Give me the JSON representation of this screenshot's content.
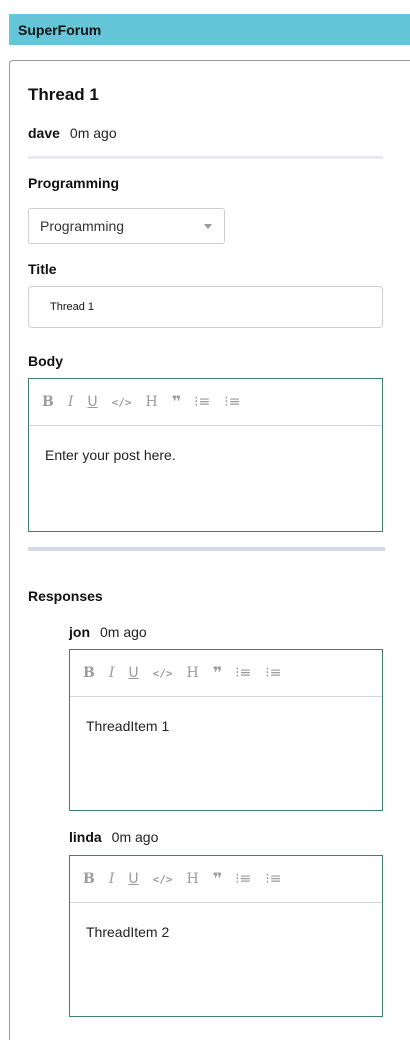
{
  "app": {
    "title": "SuperForum"
  },
  "thread": {
    "title": "Thread 1",
    "author": "dave",
    "time": "0m ago",
    "category_heading": "Programming",
    "category_selected": "Programming",
    "title_label": "Title",
    "title_value": "Thread 1",
    "body_label": "Body",
    "body_placeholder": "Enter your post here."
  },
  "toolbar": {
    "bold": "B",
    "italic": "I",
    "underline": "U",
    "code": "</>",
    "heading": "H",
    "quote": "❞",
    "ordered_list": "⁝≡",
    "bullet_list": "⁝≡"
  },
  "responses": {
    "heading": "Responses",
    "items": [
      {
        "author": "jon",
        "time": "0m ago",
        "body": "ThreadItem 1"
      },
      {
        "author": "linda",
        "time": "0m ago",
        "body": "ThreadItem 2"
      }
    ]
  },
  "colors": {
    "topbar": "#64c6d8",
    "editor_border": "#3f7f6f",
    "divider": "#d5d9ea"
  }
}
